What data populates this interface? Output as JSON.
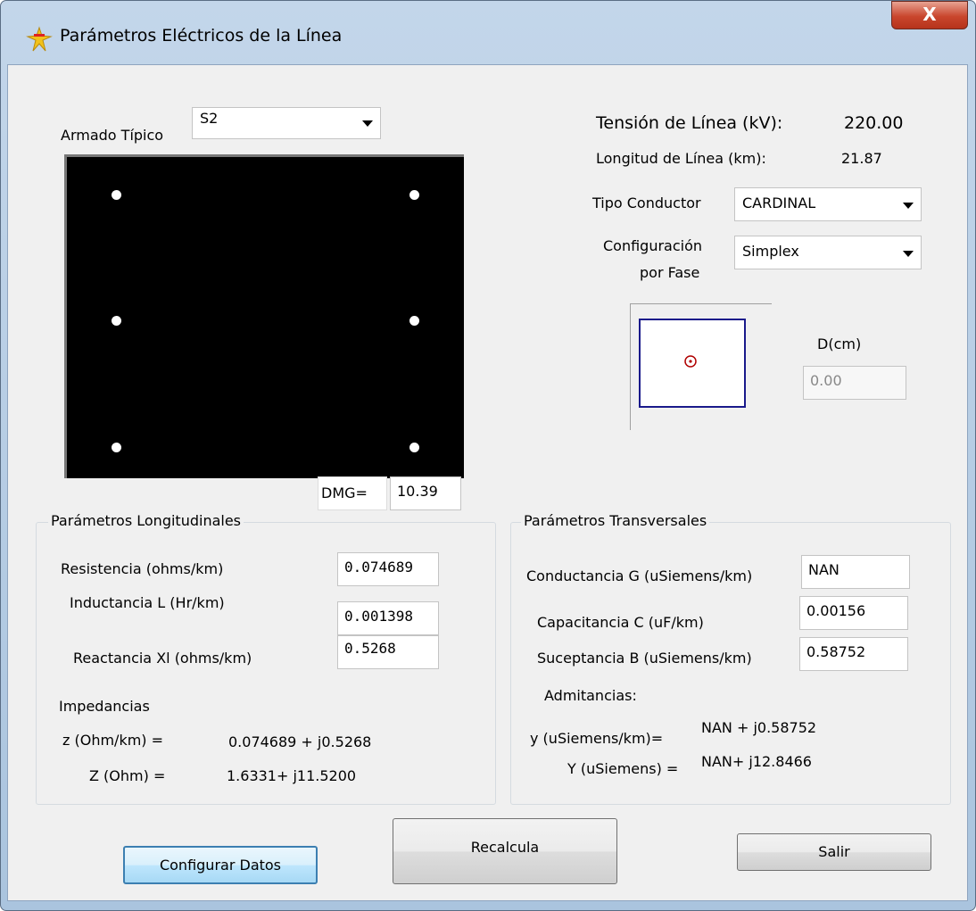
{
  "window": {
    "title": "Parámetros Eléctricos de la Línea",
    "close_label": "X"
  },
  "armado": {
    "label": "Armado Típico",
    "value": "S2"
  },
  "linea": {
    "tension_label": "Tensión de Línea (kV):",
    "tension_value": "220.00",
    "longitud_label": "Longitud de Línea (km):",
    "longitud_value": "21.87"
  },
  "conductor": {
    "label": "Tipo Conductor",
    "value": "CARDINAL"
  },
  "configuracion": {
    "label_line1": "Configuración",
    "label_line2": "por Fase",
    "value": "Simplex"
  },
  "bundle": {
    "d_label": "D(cm)",
    "d_value": "0.00"
  },
  "dmg": {
    "label": "DMG=",
    "value": "10.39"
  },
  "longitudinales": {
    "title": "Parámetros Longitudinales",
    "resistencia_label": "Resistencia (ohms/km)",
    "resistencia_value": "0.074689",
    "inductancia_label": "Inductancia L (Hr/km)",
    "inductancia_value": "0.001398",
    "reactancia_label": "Reactancia Xl (ohms/km)",
    "reactancia_value": "0.5268",
    "impedancias_label": "Impedancias",
    "z_label": "z (Ohm/km) =",
    "z_value": "0.074689 + j0.5268",
    "Z_label": "Z (Ohm) =",
    "Z_value": "1.6331+ j11.5200"
  },
  "transversales": {
    "title": "Parámetros Transversales",
    "conductancia_label": "Conductancia G (uSiemens/km)",
    "conductancia_value": "NAN",
    "capacitancia_label": "Capacitancia C (uF/km)",
    "capacitancia_value": "0.00156",
    "suceptancia_label": "Suceptancia B (uSiemens/km)",
    "suceptancia_value": "0.58752",
    "admitancias_label": "Admitancias:",
    "y_label": "y (uSiemens/km)=",
    "y_value": "NAN + j0.58752",
    "Y_label": "Y (uSiemens) =",
    "Y_value": "NAN+ j12.8466"
  },
  "buttons": {
    "configurar": "Configurar Datos",
    "recalcula": "Recalcula",
    "salir": "Salir"
  },
  "colors": {
    "title_gradient_top": "#c3d6ea",
    "close_red": "#c9462d",
    "canvas_bg": "#000000",
    "bundle_border": "#00008b",
    "conductor_red": "#b00000"
  }
}
